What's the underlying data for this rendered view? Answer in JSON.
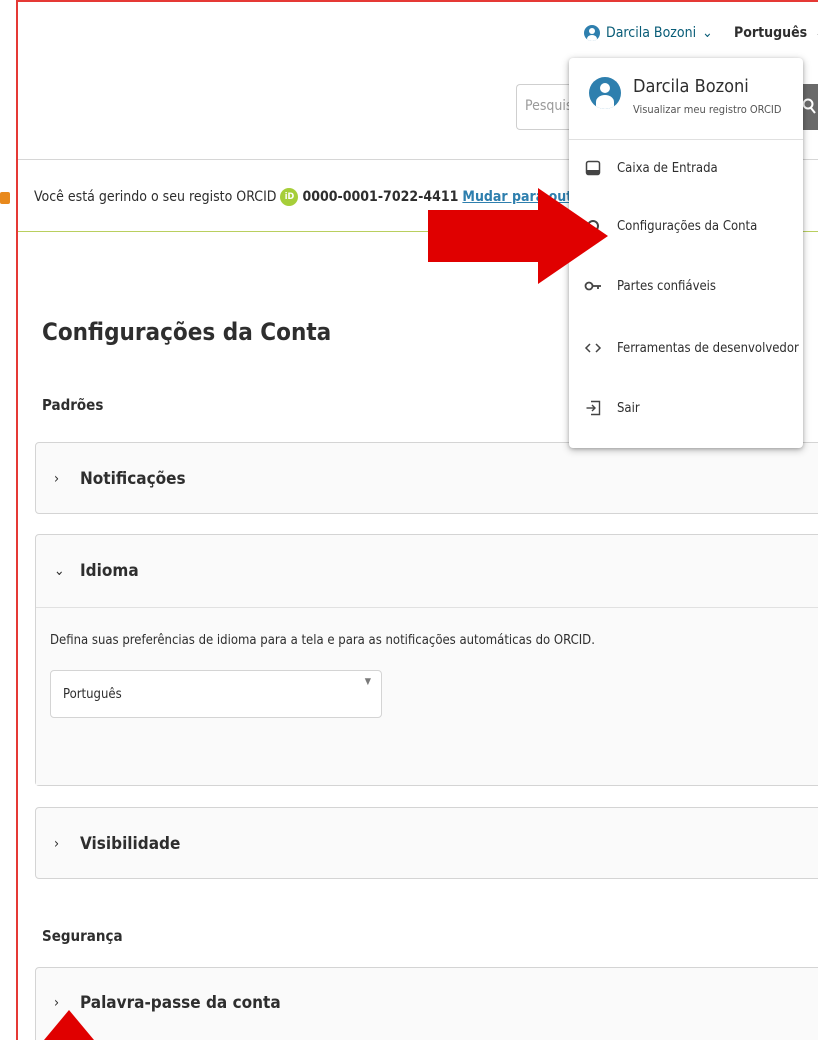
{
  "header": {
    "user_name": "Darcila Bozoni",
    "language": "Português",
    "search_placeholder": "Pesquisar"
  },
  "user_menu": {
    "name": "Darcila Bozoni",
    "subtitle": "Visualizar meu registro ORCID",
    "items": [
      {
        "label": "Caixa de Entrada",
        "icon": "inbox-icon"
      },
      {
        "label": "Configurações da Conta",
        "icon": "settings-icon"
      },
      {
        "label": "Partes confiáveis",
        "icon": "key-icon"
      },
      {
        "label": "Ferramentas de desenvolvedor",
        "icon": "code-icon"
      },
      {
        "label": "Sair",
        "icon": "logout-icon"
      }
    ]
  },
  "managing": {
    "text": "Você está gerindo o seu registo ORCID",
    "orcid_id": "0000-0001-7022-4411",
    "switch_link": "Mudar para outra cont"
  },
  "main": {
    "title": "Configurações da Conta",
    "defaults_label": "Padrões",
    "security_label": "Segurança",
    "panels": {
      "notifications": "Notificações",
      "language": "Idioma",
      "language_desc": "Defina suas preferências de idioma para a tela e para as notificações automáticas do ORCID.",
      "language_value": "Português",
      "visibility": "Visibilidade",
      "password": "Palavra-passe da conta"
    }
  },
  "colors": {
    "accent_blue": "#2e7fae",
    "orcid_green": "#a6ce39",
    "annotation_red": "#e00000"
  }
}
